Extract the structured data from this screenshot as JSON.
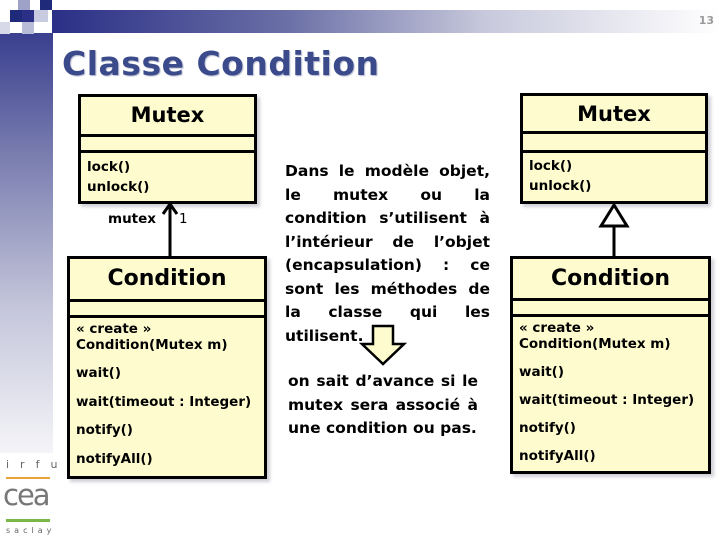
{
  "slide": {
    "page_number": "13",
    "title": "Classe Condition"
  },
  "left_diagram": {
    "mutex": {
      "name": "Mutex",
      "operations": [
        "lock()",
        "unlock()"
      ]
    },
    "association": {
      "role": "mutex",
      "multiplicity": "1"
    },
    "condition": {
      "name": "Condition",
      "stereotype": "« create »",
      "operations": [
        "Condition(Mutex m)",
        "wait()",
        "wait(timeout : Integer)",
        "notify()",
        "notifyAll()"
      ]
    }
  },
  "right_diagram": {
    "mutex": {
      "name": "Mutex",
      "operations": [
        "lock()",
        "unlock()"
      ]
    },
    "relation": "inheritance",
    "condition": {
      "name": "Condition",
      "stereotype": "« create »",
      "operations": [
        "Condition(Mutex m)",
        "wait()",
        "wait(timeout : Integer)",
        "notify()",
        "notifyAll()"
      ]
    }
  },
  "middle": {
    "explanation": "Dans le modèle objet, le mutex ou la condition s’utilisent à l’intérieur de l’objet (encapsulation) : ce sont les méthodes de la classe qui les utilisent.",
    "conclusion": "on sait d’avance si le mutex sera associé à une condition ou pas.",
    "arrow_fill": "#fefccf"
  },
  "logo": {
    "top_text": "irfu",
    "main_text": "cea",
    "bottom_text": "saclay",
    "line_top_color": "#e8a33a",
    "line_bottom_color": "#7ab648"
  }
}
